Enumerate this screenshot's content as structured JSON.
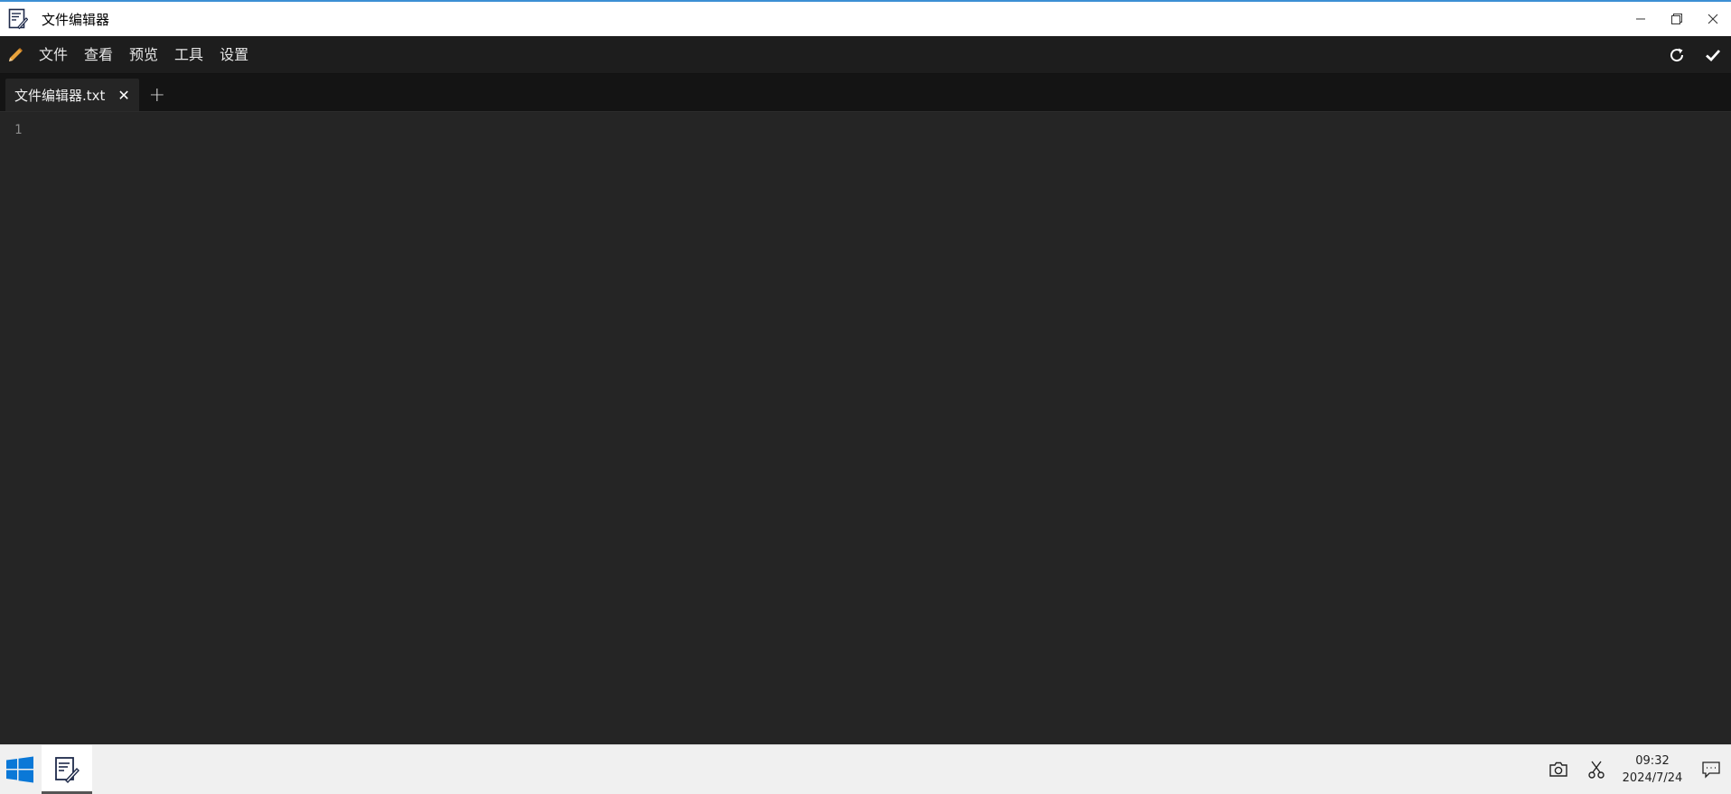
{
  "window": {
    "title": "文件编辑器",
    "controls": [
      "minimize-icon",
      "restore-icon",
      "close-icon"
    ]
  },
  "menu": {
    "items": [
      "文件",
      "查看",
      "预览",
      "工具",
      "设置"
    ],
    "right_actions": [
      "refresh-icon",
      "check-icon"
    ],
    "accent_color": "#e8a23b"
  },
  "tabs": [
    {
      "label": "文件编辑器.txt",
      "active": true
    }
  ],
  "editor": {
    "line_numbers": [
      "1"
    ],
    "content": ""
  },
  "taskbar": {
    "time": "09:32",
    "date": "2024/7/24",
    "tray_icons": [
      "camera-icon",
      "scissors-icon",
      "notification-icon"
    ]
  }
}
